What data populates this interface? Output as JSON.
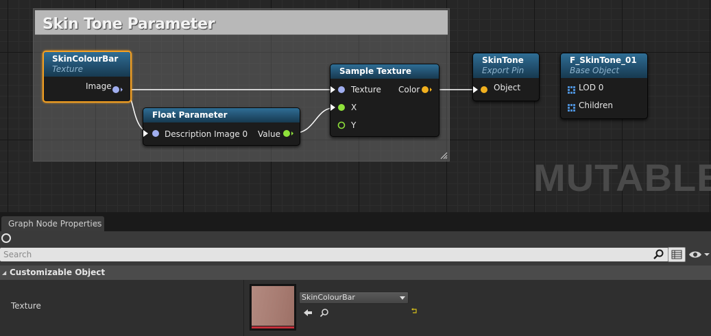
{
  "graph": {
    "comment": {
      "title": "Skin Tone Parameter"
    },
    "nodes": {
      "skin_colour_bar": {
        "title": "SkinColourBar",
        "subtitle": "Texture",
        "pins": {
          "image": "Image"
        }
      },
      "float_parameter": {
        "title": "Float Parameter",
        "pins": {
          "description_image": "Description Image 0",
          "value": "Value"
        }
      },
      "sample_texture": {
        "title": "Sample Texture",
        "pins": {
          "texture": "Texture",
          "color": "Color",
          "x": "X",
          "y": "Y"
        }
      },
      "skin_tone": {
        "title": "SkinTone",
        "subtitle": "Export Pin",
        "pins": {
          "object": "Object"
        }
      },
      "f_skintone": {
        "title": "F_SkinTone_01",
        "subtitle": "Base Object",
        "pins": {
          "lod": "LOD 0",
          "children": "Children"
        }
      }
    },
    "watermark": "MUTABLE",
    "colors": {
      "texture_pin": "#a0aeef",
      "float_pin": "#8fe23a",
      "color_pin": "#f1b01f",
      "lod_pin": "#4c8fd6",
      "selection": "#f5a020",
      "node_header": "#2f6e95"
    }
  },
  "details": {
    "tab_label": "Graph Node Properties",
    "tab_close": "×",
    "search": {
      "placeholder": "Search",
      "value": ""
    },
    "category": "Customizable Object",
    "property": {
      "name": "Texture",
      "asset": "SkinColourBar"
    },
    "icons": [
      "ring-icon",
      "search-icon",
      "view-options-icon",
      "eye-icon",
      "reset-to-default-icon",
      "use-selected-icon",
      "browse-icon"
    ]
  }
}
